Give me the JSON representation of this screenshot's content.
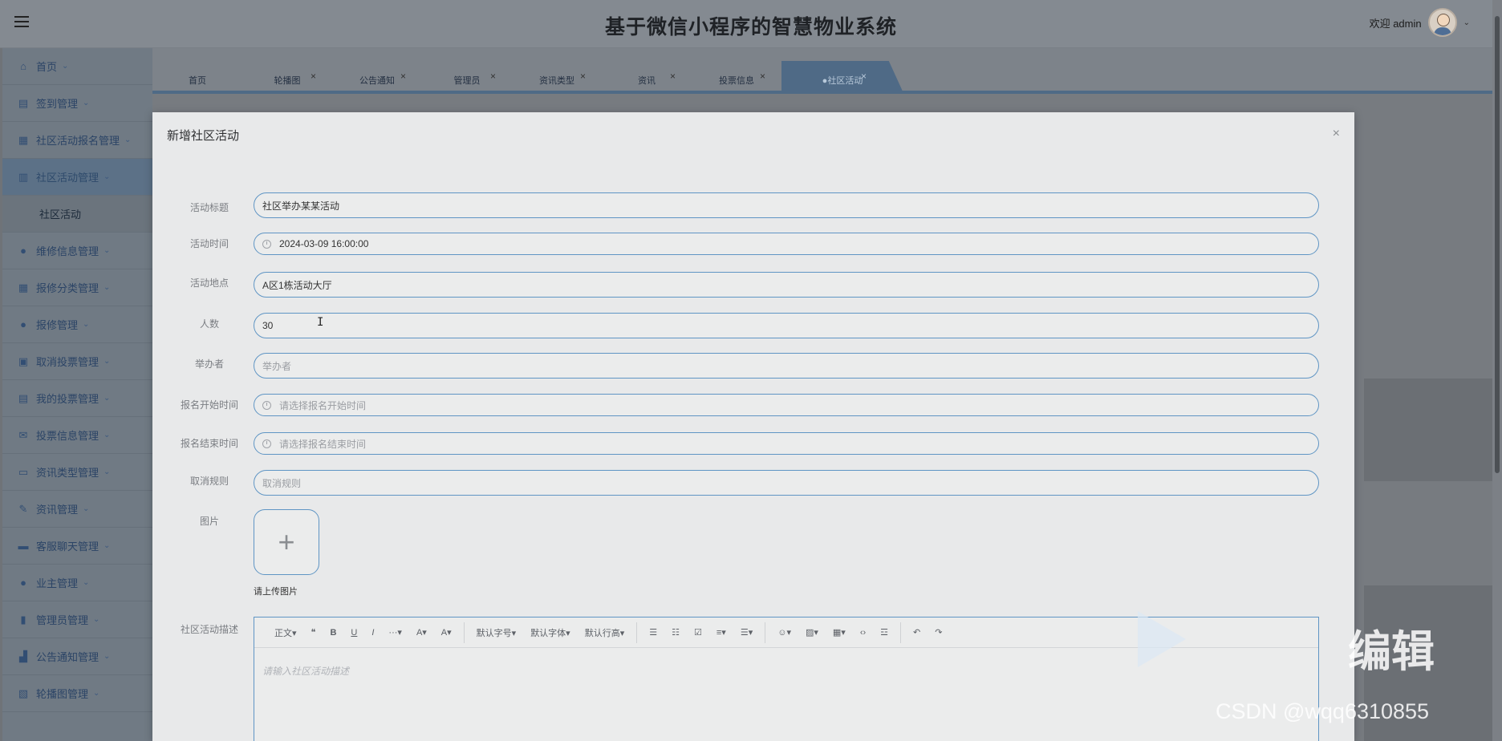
{
  "header": {
    "title": "基于微信小程序的智慧物业系统",
    "welcome": "欢迎 admin"
  },
  "sidebar": {
    "items": [
      {
        "label": "首页",
        "icon": "home-icon"
      },
      {
        "label": "签到管理",
        "icon": "chart-icon"
      },
      {
        "label": "社区活动报名管理",
        "icon": "grid-icon"
      },
      {
        "label": "社区活动管理",
        "icon": "panel-icon",
        "active": true
      },
      {
        "label": "社区活动",
        "sub": true
      },
      {
        "label": "维修信息管理",
        "icon": "circle-icon"
      },
      {
        "label": "报修分类管理",
        "icon": "grid-icon"
      },
      {
        "label": "报修管理",
        "icon": "circle-icon"
      },
      {
        "label": "取消投票管理",
        "icon": "doc-icon"
      },
      {
        "label": "我的投票管理",
        "icon": "chart-icon"
      },
      {
        "label": "投票信息管理",
        "icon": "mail-icon"
      },
      {
        "label": "资讯类型管理",
        "icon": "box-icon"
      },
      {
        "label": "资讯管理",
        "icon": "edit-icon"
      },
      {
        "label": "客服聊天管理",
        "icon": "chat-icon"
      },
      {
        "label": "业主管理",
        "icon": "drop-icon"
      },
      {
        "label": "管理员管理",
        "icon": "book-icon"
      },
      {
        "label": "公告通知管理",
        "icon": "bar-icon"
      },
      {
        "label": "轮播图管理",
        "icon": "image-icon"
      }
    ]
  },
  "tabs": [
    {
      "label": "首页",
      "closable": false
    },
    {
      "label": "轮播图",
      "closable": true
    },
    {
      "label": "公告通知",
      "closable": true
    },
    {
      "label": "管理员",
      "closable": true
    },
    {
      "label": "资讯类型",
      "closable": true
    },
    {
      "label": "资讯",
      "closable": true
    },
    {
      "label": "投票信息",
      "closable": true
    },
    {
      "label": "●社区活动",
      "closable": true,
      "active": true
    }
  ],
  "dialog": {
    "title": "新增社区活动",
    "close_glyph": "×",
    "fields": {
      "title": {
        "label": "活动标题",
        "value": "社区举办某某活动"
      },
      "time": {
        "label": "活动时间",
        "value": "2024-03-09 16:00:00"
      },
      "location": {
        "label": "活动地点",
        "value": "A区1栋活动大厅"
      },
      "count": {
        "label": "人数",
        "value": "30"
      },
      "organizer": {
        "label": "举办者",
        "placeholder": "举办者"
      },
      "signup_start": {
        "label": "报名开始时间",
        "placeholder": "请选择报名开始时间"
      },
      "signup_end": {
        "label": "报名结束时间",
        "placeholder": "请选择报名结束时间"
      },
      "cancel_rule": {
        "label": "取消规则",
        "placeholder": "取消规则"
      },
      "image": {
        "label": "图片",
        "hint": "请上传图片"
      },
      "description": {
        "label": "社区活动描述",
        "placeholder": "请输入社区活动描述"
      }
    },
    "editor_toolbar": [
      "正文▾",
      "❝",
      "B",
      "U",
      "I",
      "···▾",
      "A▾",
      "A▾",
      "默认字号▾",
      "默认字体▾",
      "默认行高▾",
      "☰",
      "☷",
      "☑",
      "≡▾",
      "☰▾",
      "☺▾",
      "▨▾",
      "▦▾",
      "‹›",
      "☲",
      "↶",
      "↷"
    ]
  },
  "watermark": {
    "editor_text": "编辑",
    "csdn": "CSDN @wqq6310855"
  }
}
